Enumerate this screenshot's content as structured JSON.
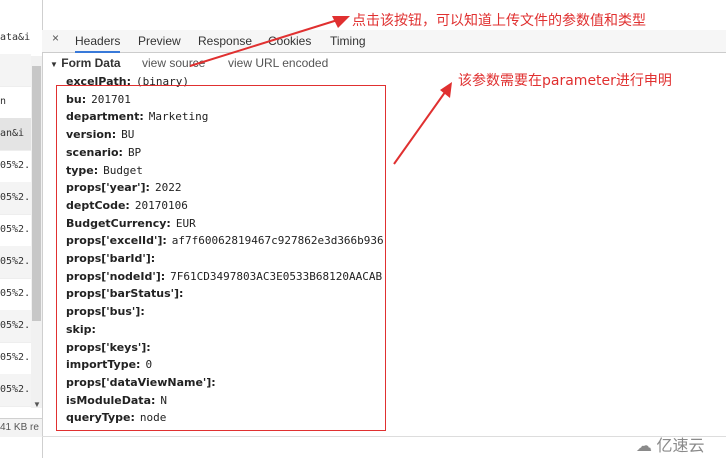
{
  "left_panel": {
    "rows": [
      "ata&i",
      "",
      "n",
      "an&i",
      "05%2.",
      "05%2.",
      "05%2.",
      "05%2.",
      "05%2.",
      "05%2.",
      "05%2.",
      "05%2."
    ],
    "status": "41 KB re"
  },
  "tabs": [
    "Headers",
    "Preview",
    "Response",
    "Cookies",
    "Timing"
  ],
  "form_data": {
    "title": "Form Data",
    "view_source": "view source",
    "view_url_encoded": "view URL encoded",
    "params": [
      {
        "key": "excelPath:",
        "value": "(binary)"
      },
      {
        "key": "bu:",
        "value": "201701"
      },
      {
        "key": "department:",
        "value": "Marketing"
      },
      {
        "key": "version:",
        "value": "BU"
      },
      {
        "key": "scenario:",
        "value": "BP"
      },
      {
        "key": "type:",
        "value": "Budget"
      },
      {
        "key": "props['year']:",
        "value": "2022"
      },
      {
        "key": "deptCode:",
        "value": "20170106"
      },
      {
        "key": "BudgetCurrency:",
        "value": "EUR"
      },
      {
        "key": "props['excelId']:",
        "value": "af7f60062819467c927862e3d366b936"
      },
      {
        "key": "props['barId']:",
        "value": ""
      },
      {
        "key": "props['nodeId']:",
        "value": "7F61CD3497803AC3E0533B68120AACAB"
      },
      {
        "key": "props['barStatus']:",
        "value": ""
      },
      {
        "key": "props['bus']:",
        "value": ""
      },
      {
        "key": "skip:",
        "value": ""
      },
      {
        "key": "props['keys']:",
        "value": ""
      },
      {
        "key": "importType:",
        "value": "0"
      },
      {
        "key": "props['dataViewName']:",
        "value": ""
      },
      {
        "key": "isModuleData:",
        "value": "N"
      },
      {
        "key": "queryType:",
        "value": "node"
      }
    ]
  },
  "annotations": {
    "top": "点击该按钮，可以知道上传文件的参数值和类型",
    "right": "该参数需要在parameter进行申明"
  },
  "watermark": "亿速云",
  "colors": {
    "annotation": "#e03030",
    "active_tab": "#3879d9"
  }
}
